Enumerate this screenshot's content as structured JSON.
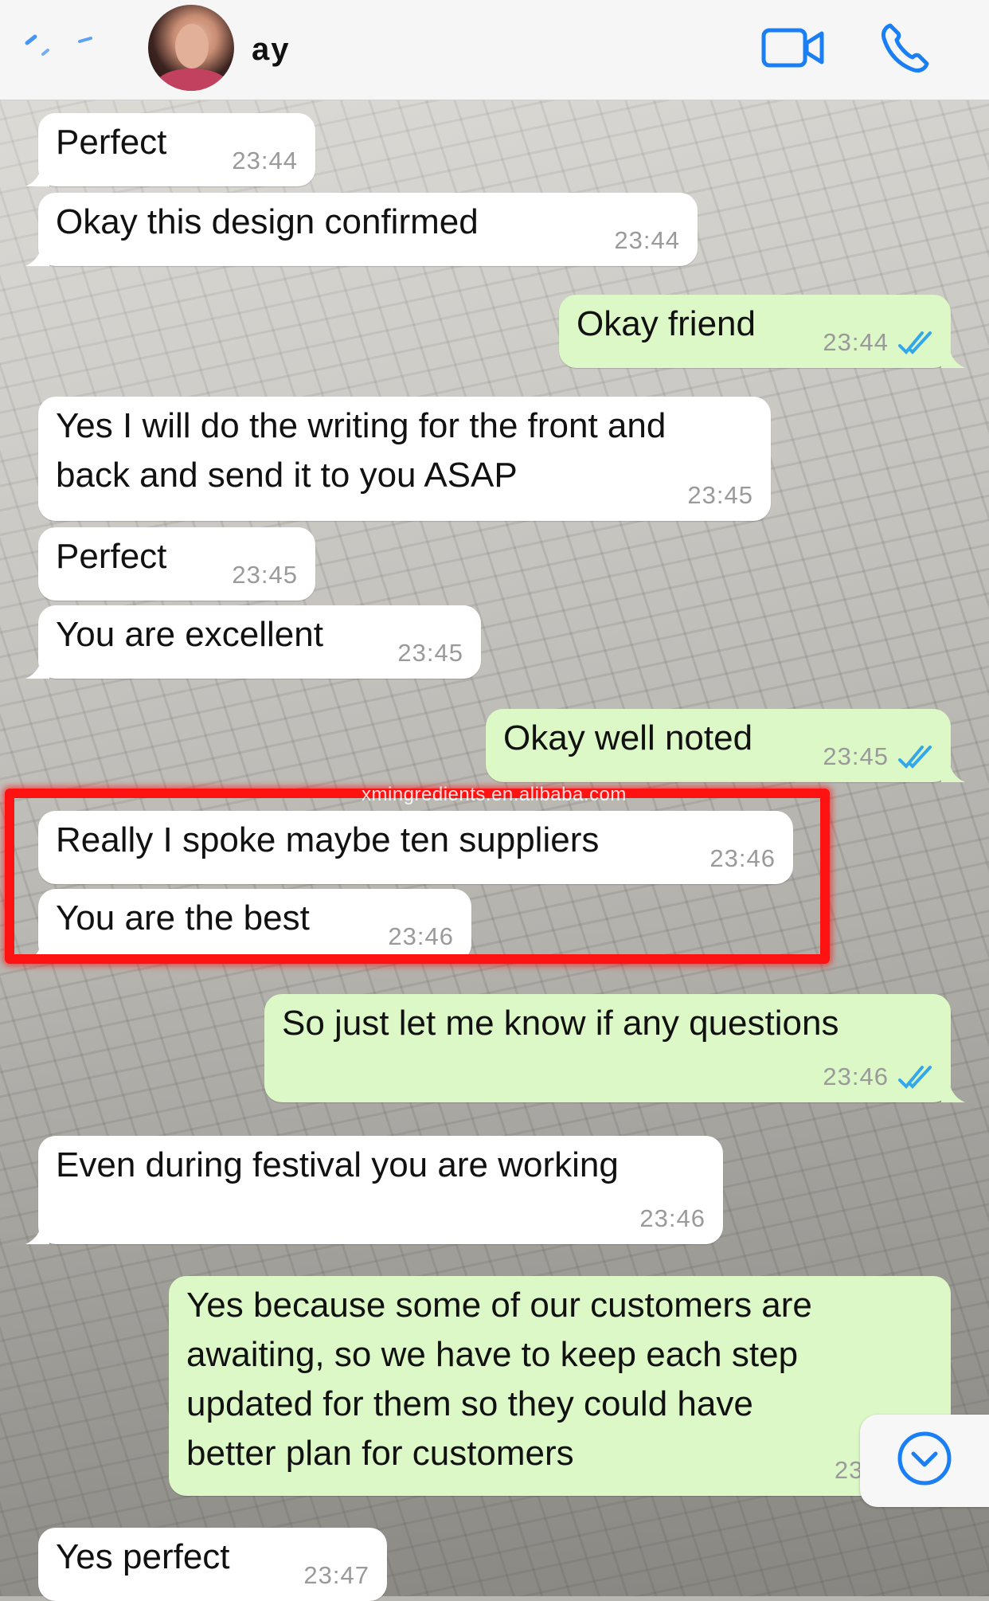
{
  "header": {
    "contact_name": "ay",
    "back_icon": "back-chevron-icon",
    "video_icon": "video-call-icon",
    "phone_icon": "phone-call-icon",
    "accent_color": "#1a7ff5"
  },
  "messages": [
    {
      "dir": "in",
      "text": [
        "Perfect"
      ],
      "time": "23:44"
    },
    {
      "dir": "in",
      "text": [
        "Okay this design confirmed"
      ],
      "time": "23:44"
    },
    {
      "dir": "out",
      "text": [
        "Okay friend"
      ],
      "time": "23:44",
      "status": "read"
    },
    {
      "dir": "in",
      "text": [
        "Yes I will do the writing for the front and",
        "back and send it to you ASAP"
      ],
      "time": "23:45"
    },
    {
      "dir": "in",
      "text": [
        "Perfect"
      ],
      "time": "23:45"
    },
    {
      "dir": "in",
      "text": [
        "You are excellent"
      ],
      "time": "23:45"
    },
    {
      "dir": "out",
      "text": [
        "Okay well noted"
      ],
      "time": "23:45",
      "status": "read"
    },
    {
      "dir": "in",
      "text": [
        "Really I spoke maybe ten suppliers"
      ],
      "time": "23:46"
    },
    {
      "dir": "in",
      "text": [
        "You are the best"
      ],
      "time": "23:46"
    },
    {
      "dir": "out",
      "text": [
        "So just let me know if any questions"
      ],
      "time": "23:46",
      "status": "read"
    },
    {
      "dir": "in",
      "text": [
        "Even during festival you are working"
      ],
      "time": "23:46"
    },
    {
      "dir": "out",
      "text": [
        "Yes because some of our customers are",
        "awaiting, so we have to keep each step",
        "updated for them so they could have",
        "better plan for customers"
      ],
      "time": "23:"
    },
    {
      "dir": "in",
      "text": [
        "Yes perfect"
      ],
      "time": "23:47"
    }
  ],
  "watermark": "xmingredients.en.alibaba.com",
  "colors": {
    "incoming_bubble": "#ffffff",
    "outgoing_bubble": "#dcf8c6",
    "read_ticks": "#34a7e8",
    "highlight_box": "#ff1212"
  },
  "scroll_down_icon": "chevron-down-circle-icon"
}
